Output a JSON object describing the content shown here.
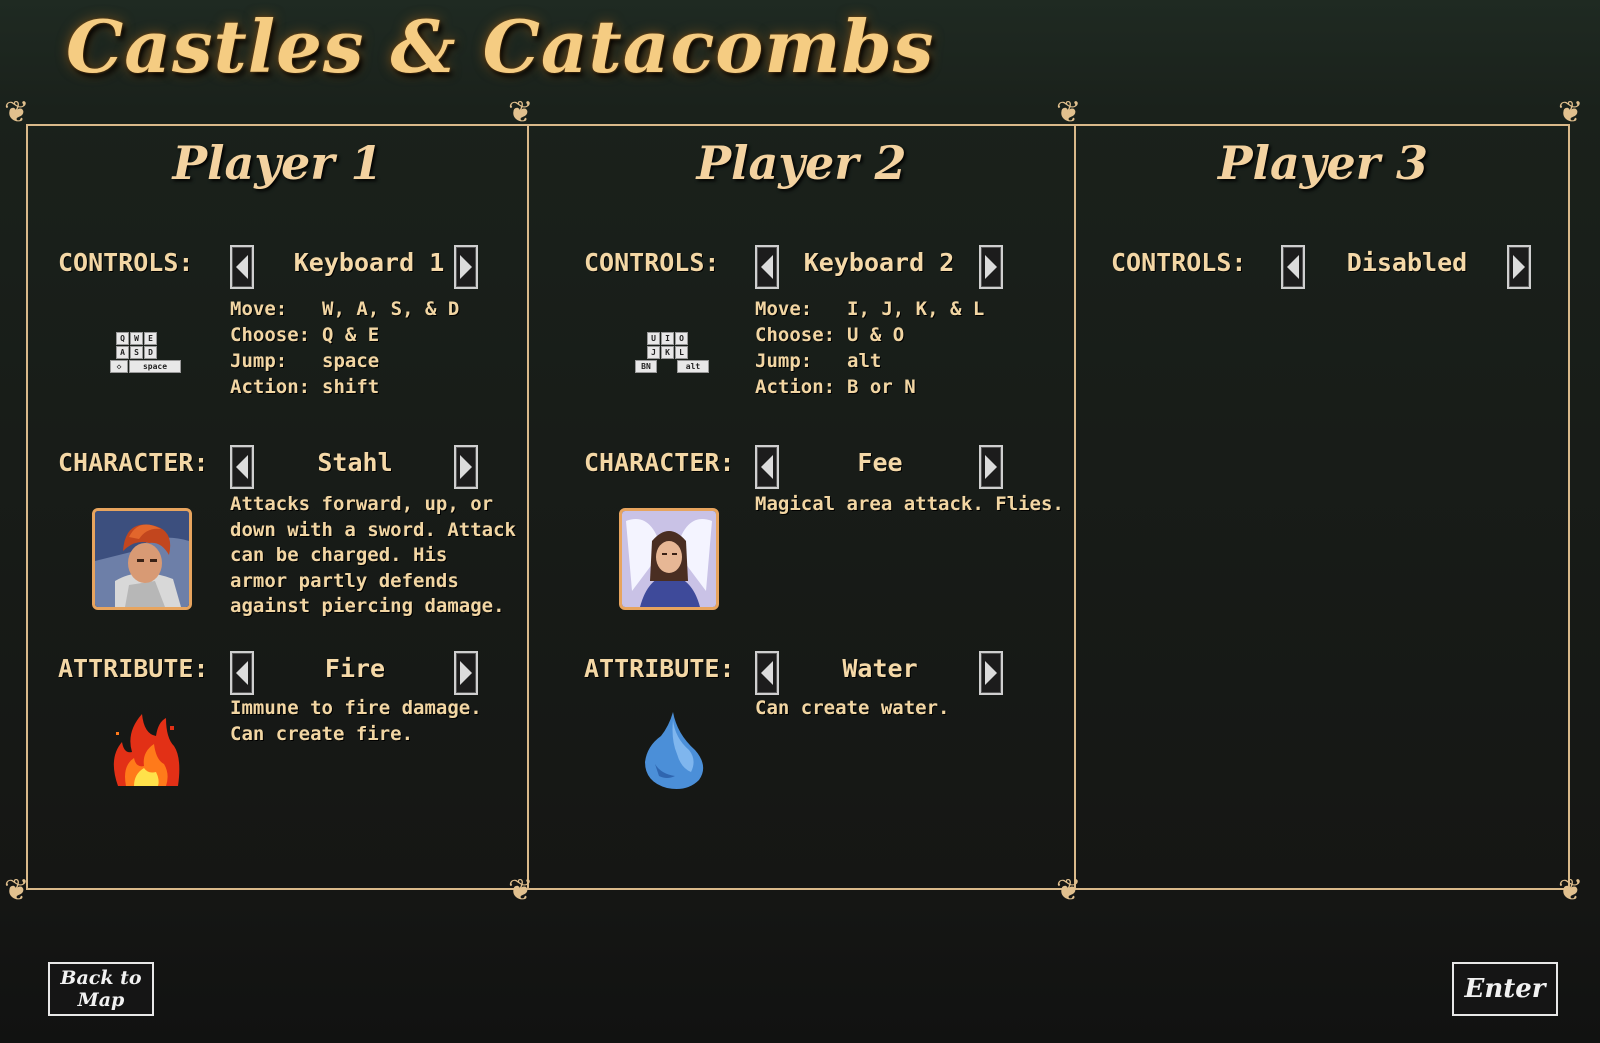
{
  "title": "Castles & Catacombs",
  "labels": {
    "controls": "CONTROLS:",
    "character": "CHARACTER:",
    "attribute": "ATTRIBUTE:"
  },
  "players": [
    {
      "heading": "Player 1",
      "controls": "Keyboard 1",
      "key_icon": {
        "row1": [
          "Q",
          "W",
          "E"
        ],
        "row2": [
          "A",
          "S",
          "D"
        ],
        "row3a": "◇",
        "row3b": "space"
      },
      "move_label": "Move:",
      "move": "W, A, S, & D",
      "choose_label": "Choose:",
      "choose": "Q & E",
      "jump_label": "Jump:",
      "jump": "space",
      "action_label": "Action:",
      "action": "shift",
      "character": "Stahl",
      "character_desc": [
        "Attacks forward, up, or",
        "down with a sword. Attack",
        "can be charged. His",
        "armor partly defends",
        "against piercing damage."
      ],
      "attribute": "Fire",
      "attribute_desc": [
        "Immune to fire damage.",
        "Can create fire."
      ],
      "attribute_icon": "fire-icon"
    },
    {
      "heading": "Player 2",
      "controls": "Keyboard 2",
      "key_icon": {
        "row1": [
          "U",
          "I",
          "O"
        ],
        "row2": [
          "J",
          "K",
          "L"
        ],
        "row3a": "BN",
        "row3b": "alt"
      },
      "move_label": "Move:",
      "move": "I, J, K, & L",
      "choose_label": "Choose:",
      "choose": "U & O",
      "jump_label": "Jump:",
      "jump": "alt",
      "action_label": "Action:",
      "action": "B or N",
      "character": "Fee",
      "character_desc": [
        "Magical area attack. Flies."
      ],
      "attribute": "Water",
      "attribute_desc": [
        "Can create water."
      ],
      "attribute_icon": "water-drop-icon"
    },
    {
      "heading": "Player 3",
      "controls": "Disabled"
    }
  ],
  "buttons": {
    "back": "Back to Map",
    "enter": "Enter"
  },
  "colors": {
    "frame": "#d9b98a",
    "title": "#f5cc82",
    "text": "#f3d7a5"
  }
}
